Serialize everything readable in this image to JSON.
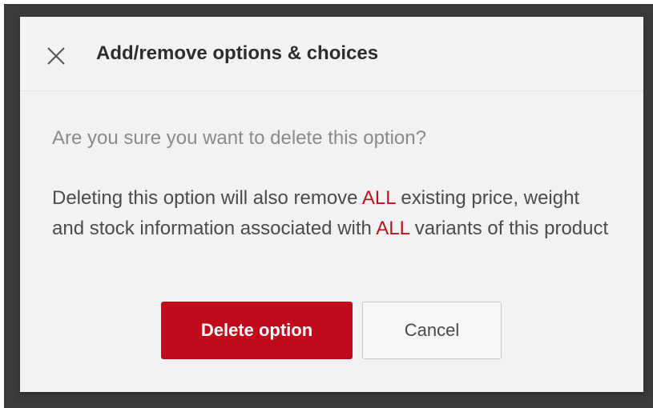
{
  "dialog": {
    "title": "Add/remove options & choices",
    "close_icon": "close-icon",
    "question": "Are you sure you want to delete this option?",
    "warning": {
      "part1": "Deleting this option will also remove ",
      "emph1": "ALL",
      "part2": " existing price, weight and stock information associated with ",
      "emph2": "ALL",
      "part3": " variants of this product"
    },
    "buttons": {
      "delete_label": "Delete option",
      "cancel_label": "Cancel"
    }
  },
  "colors": {
    "accent": "#c10a1c",
    "emphasis_text": "#c0101f",
    "backdrop": "#3b3b3b",
    "dialog_bg": "#f2f2f2"
  }
}
